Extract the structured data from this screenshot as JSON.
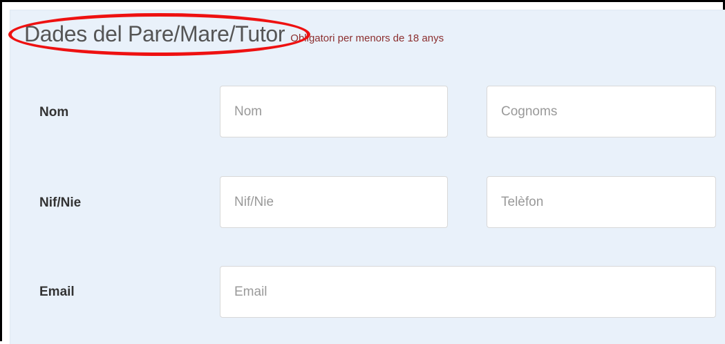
{
  "section": {
    "title": "Dades del Pare/Mare/Tutor",
    "note": "Obligatori per menors de 18 anys"
  },
  "rows": {
    "name": {
      "label": "Nom",
      "first_placeholder": "Nom",
      "second_placeholder": "Cognoms"
    },
    "id": {
      "label": "Nif/Nie",
      "first_placeholder": "Nif/Nie",
      "second_placeholder": "Telèfon"
    },
    "email": {
      "label": "Email",
      "placeholder": "Email"
    }
  },
  "colors": {
    "panel_background": "#e9f1fa",
    "note_text": "#8b2e2e",
    "highlight_ellipse": "#ee1111"
  }
}
